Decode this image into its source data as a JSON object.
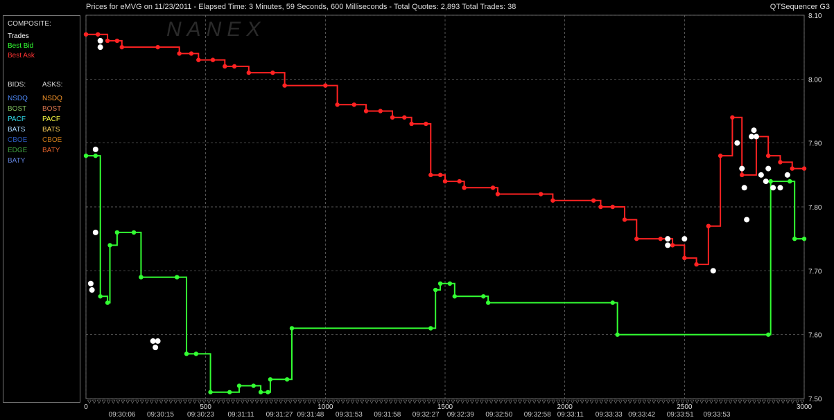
{
  "window": {
    "title": "Prices for  eMVG  on  11/23/2011  -  Elapsed Time: 3 Minutes, 59 Seconds, 600 Milliseconds  -  Total Quotes: 2,893  Total Trades: 38",
    "app_name": "QTSequencer G3",
    "watermark": "NANEX"
  },
  "legend": {
    "composite_header": "COMPOSITE:",
    "composite": [
      {
        "label": "Trades",
        "color": "#ffffff"
      },
      {
        "label": "Best Bid",
        "color": "#33ff33"
      },
      {
        "label": "Best Ask",
        "color": "#ff2222"
      }
    ],
    "bids_header": "BIDS:",
    "asks_header": "ASKS:",
    "bids": [
      {
        "label": "NSDQ",
        "color": "#4f8cff"
      },
      {
        "label": "BOST",
        "color": "#7fbf5f"
      },
      {
        "label": "PACF",
        "color": "#33e0ee"
      },
      {
        "label": "BATS",
        "color": "#a8d8ff"
      },
      {
        "label": "CBOE",
        "color": "#2b58b8"
      },
      {
        "label": "EDGE",
        "color": "#3fa03f"
      },
      {
        "label": "BATY",
        "color": "#5e7fd8"
      }
    ],
    "asks": [
      {
        "label": "NSDQ",
        "color": "#ff9a2a"
      },
      {
        "label": "BOST",
        "color": "#e07850"
      },
      {
        "label": "PACF",
        "color": "#ffff44"
      },
      {
        "label": "BATS",
        "color": "#ffd25a"
      },
      {
        "label": "CBOE",
        "color": "#c87818"
      },
      {
        "label": "BATY",
        "color": "#e0602a"
      }
    ]
  },
  "chart_data": {
    "type": "line",
    "x_label": "",
    "y_label": "",
    "xlim": [
      0,
      3000
    ],
    "ylim": [
      7.5,
      8.1
    ],
    "grid": true,
    "x_ticks": [
      0,
      500,
      1000,
      1500,
      2000,
      2500,
      3000
    ],
    "y_ticks": [
      7.5,
      7.6,
      7.7,
      7.8,
      7.9,
      8.0,
      8.1
    ],
    "y_tick_labels": [
      "7.50",
      "7.60",
      "7.70",
      "7.80",
      "7.90",
      "8.00",
      "8.10"
    ],
    "time_labels": [
      {
        "x": 150,
        "label": "09:30:06"
      },
      {
        "x": 360,
        "label": "09:30:15"
      },
      {
        "x": 580,
        "label": "09:30:23"
      },
      {
        "x": 800,
        "label": "09:31:11"
      },
      {
        "x": 1010,
        "label": "09:31:27"
      },
      {
        "x": 1180,
        "label": "09:31:48"
      },
      {
        "x": 1390,
        "label": "09:31:53"
      },
      {
        "x": 1600,
        "label": "09:31:58"
      },
      {
        "x": 1810,
        "label": "09:32:27"
      },
      {
        "x": 2000,
        "label": "09:32:39"
      },
      {
        "x": 2210,
        "label": "09:32:50"
      },
      {
        "x": 2420,
        "label": "09:32:58"
      },
      {
        "x": 2600,
        "label": "09:33:11"
      },
      {
        "x": 2810,
        "label": "09:33:33"
      },
      {
        "x": 2990,
        "label": "09:33:42"
      },
      {
        "x": 3200,
        "label": "09:33:51"
      },
      {
        "x": 3400,
        "label": "09:33:53"
      }
    ],
    "series": [
      {
        "name": "Best Ask",
        "color": "#ff2222",
        "points": [
          [
            0,
            8.07
          ],
          [
            50,
            8.07
          ],
          [
            90,
            8.06
          ],
          [
            130,
            8.06
          ],
          [
            150,
            8.05
          ],
          [
            300,
            8.05
          ],
          [
            390,
            8.04
          ],
          [
            440,
            8.04
          ],
          [
            470,
            8.03
          ],
          [
            530,
            8.03
          ],
          [
            580,
            8.02
          ],
          [
            620,
            8.02
          ],
          [
            680,
            8.01
          ],
          [
            780,
            8.01
          ],
          [
            830,
            7.99
          ],
          [
            1000,
            7.99
          ],
          [
            1050,
            7.96
          ],
          [
            1120,
            7.96
          ],
          [
            1170,
            7.95
          ],
          [
            1230,
            7.95
          ],
          [
            1280,
            7.94
          ],
          [
            1330,
            7.94
          ],
          [
            1360,
            7.93
          ],
          [
            1420,
            7.93
          ],
          [
            1440,
            7.85
          ],
          [
            1480,
            7.85
          ],
          [
            1500,
            7.84
          ],
          [
            1560,
            7.84
          ],
          [
            1580,
            7.83
          ],
          [
            1700,
            7.83
          ],
          [
            1720,
            7.82
          ],
          [
            1900,
            7.82
          ],
          [
            1950,
            7.81
          ],
          [
            2120,
            7.81
          ],
          [
            2150,
            7.8
          ],
          [
            2200,
            7.8
          ],
          [
            2250,
            7.78
          ],
          [
            2300,
            7.75
          ],
          [
            2400,
            7.75
          ],
          [
            2450,
            7.74
          ],
          [
            2500,
            7.72
          ],
          [
            2550,
            7.71
          ],
          [
            2600,
            7.77
          ],
          [
            2650,
            7.88
          ],
          [
            2700,
            7.94
          ],
          [
            2740,
            7.85
          ],
          [
            2800,
            7.91
          ],
          [
            2850,
            7.88
          ],
          [
            2900,
            7.87
          ],
          [
            2950,
            7.86
          ],
          [
            3000,
            7.86
          ]
        ]
      },
      {
        "name": "Best Bid",
        "color": "#33ff33",
        "points": [
          [
            0,
            7.88
          ],
          [
            40,
            7.88
          ],
          [
            60,
            7.66
          ],
          [
            90,
            7.65
          ],
          [
            100,
            7.74
          ],
          [
            130,
            7.76
          ],
          [
            200,
            7.76
          ],
          [
            230,
            7.69
          ],
          [
            380,
            7.69
          ],
          [
            420,
            7.57
          ],
          [
            460,
            7.57
          ],
          [
            520,
            7.51
          ],
          [
            600,
            7.51
          ],
          [
            640,
            7.52
          ],
          [
            700,
            7.52
          ],
          [
            730,
            7.51
          ],
          [
            760,
            7.51
          ],
          [
            770,
            7.53
          ],
          [
            840,
            7.53
          ],
          [
            860,
            7.61
          ],
          [
            1440,
            7.61
          ],
          [
            1460,
            7.67
          ],
          [
            1480,
            7.68
          ],
          [
            1520,
            7.68
          ],
          [
            1540,
            7.66
          ],
          [
            1660,
            7.66
          ],
          [
            1680,
            7.65
          ],
          [
            2200,
            7.65
          ],
          [
            2220,
            7.6
          ],
          [
            2850,
            7.6
          ],
          [
            2860,
            7.84
          ],
          [
            2940,
            7.84
          ],
          [
            2960,
            7.75
          ],
          [
            3000,
            7.75
          ]
        ]
      }
    ],
    "trades": [
      [
        60,
        8.06
      ],
      [
        60,
        8.05
      ],
      [
        40,
        7.89
      ],
      [
        20,
        7.68
      ],
      [
        25,
        7.67
      ],
      [
        40,
        7.76
      ],
      [
        280,
        7.59
      ],
      [
        290,
        7.58
      ],
      [
        300,
        7.59
      ],
      [
        2430,
        7.75
      ],
      [
        2430,
        7.74
      ],
      [
        2500,
        7.75
      ],
      [
        2620,
        7.7
      ],
      [
        2720,
        7.9
      ],
      [
        2740,
        7.86
      ],
      [
        2750,
        7.83
      ],
      [
        2760,
        7.78
      ],
      [
        2780,
        7.91
      ],
      [
        2790,
        7.92
      ],
      [
        2800,
        7.91
      ],
      [
        2820,
        7.85
      ],
      [
        2840,
        7.84
      ],
      [
        2850,
        7.86
      ],
      [
        2870,
        7.83
      ],
      [
        2900,
        7.83
      ],
      [
        2930,
        7.85
      ]
    ]
  }
}
